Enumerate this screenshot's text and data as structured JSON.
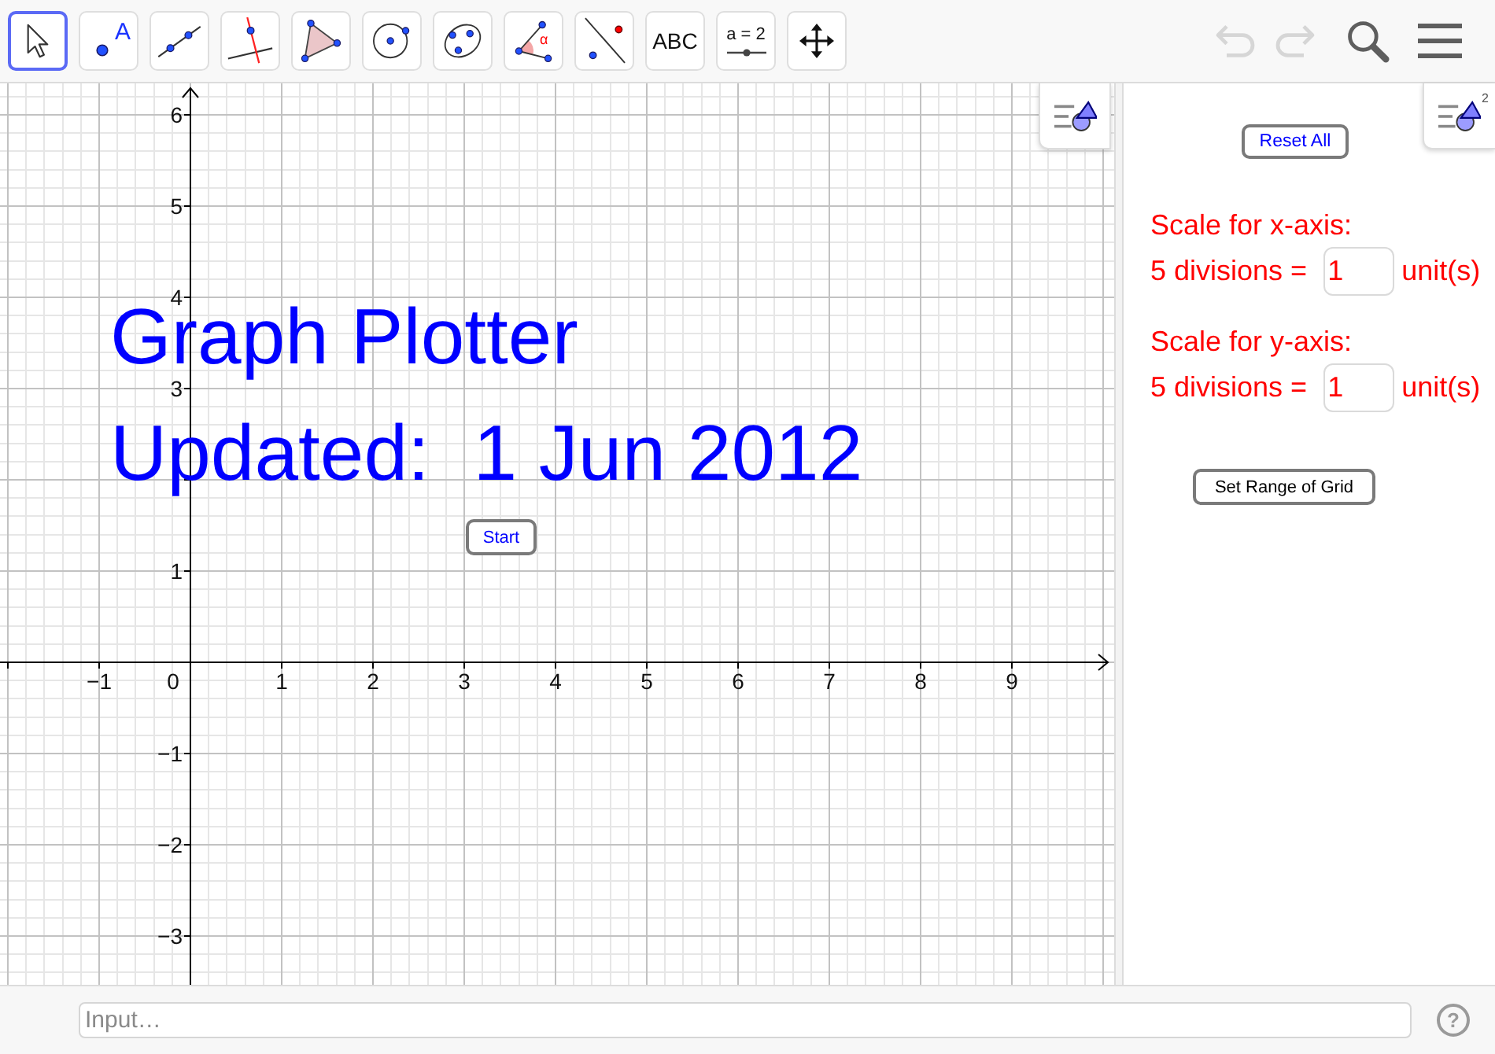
{
  "toolbar": {
    "tools": [
      {
        "kind": "move",
        "selected": true
      },
      {
        "kind": "point",
        "label": "A",
        "selected": false
      },
      {
        "kind": "line",
        "selected": false
      },
      {
        "kind": "perpendicular",
        "selected": false
      },
      {
        "kind": "polygon",
        "selected": false
      },
      {
        "kind": "circle",
        "selected": false
      },
      {
        "kind": "conic",
        "selected": false
      },
      {
        "kind": "angle",
        "label": "α",
        "selected": false
      },
      {
        "kind": "reflect",
        "selected": false
      },
      {
        "kind": "text",
        "label": "ABC",
        "selected": false
      },
      {
        "kind": "slider",
        "label": "a = 2",
        "selected": false
      },
      {
        "kind": "move_view",
        "selected": false
      }
    ],
    "actions": [
      {
        "kind": "undo",
        "disabled": true
      },
      {
        "kind": "redo",
        "disabled": true
      },
      {
        "kind": "search",
        "disabled": false
      },
      {
        "kind": "menu",
        "disabled": false
      }
    ]
  },
  "graphics_view": {
    "title": "Graph Plotter",
    "subtitle": "Updated:  1 Jun 2012",
    "start_button": "Start",
    "origin_label": "0",
    "x_labels": [
      "−1",
      "1",
      "2",
      "3",
      "4",
      "5",
      "6",
      "7",
      "8",
      "9"
    ],
    "y_labels": [
      "6",
      "5",
      "4",
      "3",
      "1",
      "−1",
      "−2",
      "−3"
    ]
  },
  "side_panel": {
    "style_bar_badge": "2",
    "reset_button": "Reset All",
    "scales": [
      {
        "heading": "Scale for x-axis:",
        "label": "5 divisions =",
        "value": "1",
        "unit": "unit(s)"
      },
      {
        "heading": "Scale for y-axis:",
        "label": "5 divisions =",
        "value": "1",
        "unit": "unit(s)"
      }
    ],
    "range_button": "Set Range of Grid"
  },
  "input_bar": {
    "placeholder": "Input…",
    "help": "?"
  }
}
